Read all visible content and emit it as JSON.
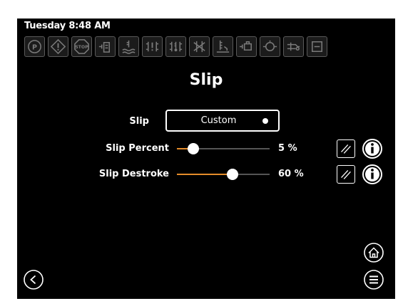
{
  "status": {
    "clock": "Tuesday 8:48 AM"
  },
  "indicators": [
    {
      "icon": "parking-brake-icon"
    },
    {
      "icon": "warning-icon"
    },
    {
      "icon": "stop-icon",
      "text": "STOP"
    },
    {
      "icon": "hydraulic-pressure-icon"
    },
    {
      "icon": "coolant-temperature-icon"
    },
    {
      "icon": "transmission-fault-icon"
    },
    {
      "icon": "transmission-temperature-icon"
    },
    {
      "icon": "transmission-filter-icon"
    },
    {
      "icon": "oil-level-icon"
    },
    {
      "icon": "oil-pressure-icon"
    },
    {
      "icon": "filter-icon"
    },
    {
      "icon": "tow-icon"
    },
    {
      "icon": "fuel-icon"
    }
  ],
  "page": {
    "title": "Slip"
  },
  "settings": {
    "slip": {
      "label": "Slip",
      "value": "Custom"
    },
    "slip_percent": {
      "label": "Slip Percent",
      "value_text": "5 %",
      "level": 0.18
    },
    "slip_destroke": {
      "label": "Slip Destroke",
      "value_text": "60 %",
      "level": 0.6
    }
  },
  "colors": {
    "accent": "#e58c2a",
    "background": "#000000",
    "foreground": "#ffffff"
  }
}
